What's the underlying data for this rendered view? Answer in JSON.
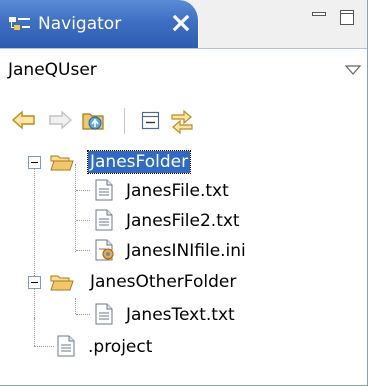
{
  "view_tab": {
    "title": "Navigator",
    "icon": "navigator-icon"
  },
  "window_controls": [
    "minimize-icon",
    "maximize-icon"
  ],
  "working_set": {
    "value": "JaneQUser"
  },
  "toolbar": {
    "buttons": [
      "back-arrow-icon",
      "forward-arrow-icon",
      "up-folder-icon",
      "collapse-all-icon",
      "link-with-editor-icon"
    ]
  },
  "tree": {
    "folder1": {
      "label": "JanesFolder",
      "selected": true
    },
    "file1": {
      "label": "JanesFile.txt"
    },
    "file2": {
      "label": "JanesFile2.txt"
    },
    "file3": {
      "label": "JanesINIfile.ini"
    },
    "folder2": {
      "label": "JanesOtherFolder"
    },
    "file4": {
      "label": "JanesText.txt"
    },
    "file5": {
      "label": ".project"
    }
  },
  "colors": {
    "tab_blue": "#3f6fc3",
    "selection": "#316ac5",
    "folder": "#f2c76a"
  }
}
